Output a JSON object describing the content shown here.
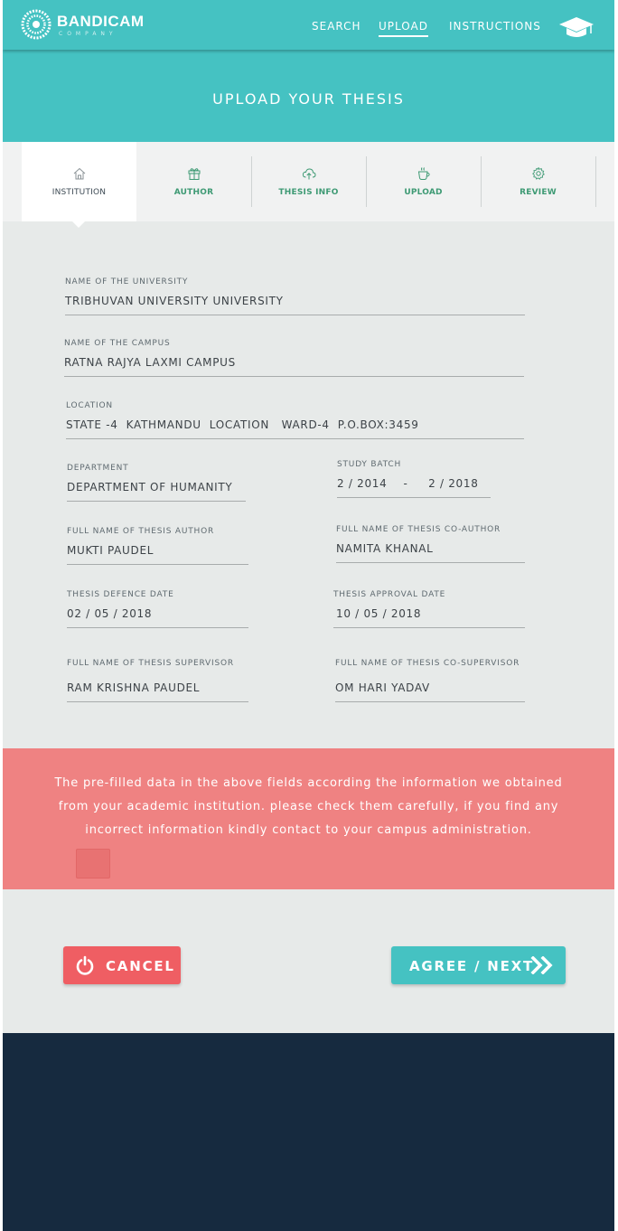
{
  "brand": {
    "name": "BANDICAM",
    "sub": "COMPANY"
  },
  "nav": {
    "search": "SEARCH",
    "upload": "UPLOAD",
    "instructions": "INSTRUCTIONS"
  },
  "page_title": "UPLOAD YOUR THESIS",
  "tabs": [
    {
      "label": "INSTITUTION",
      "icon": "home-icon",
      "active": true
    },
    {
      "label": "AUTHOR",
      "icon": "gift-icon"
    },
    {
      "label": "THESIS INFO",
      "icon": "cloud-upload-icon"
    },
    {
      "label": "UPLOAD",
      "icon": "coffee-cup-icon"
    },
    {
      "label": "REVIEW",
      "icon": "gear-icon"
    }
  ],
  "form": {
    "university": {
      "label": "NAME OF THE UNIVERSITY",
      "value": "TRIBHUVAN UNIVERSITY UNIVERSITY"
    },
    "campus": {
      "label": "NAME OF THE CAMPUS",
      "value": "RATNA RAJYA LAXMI CAMPUS"
    },
    "location": {
      "label": "LOCATION",
      "value": "STATE -4  KATHMANDU  LOCATION   WARD-4  P.O.BOX:3459"
    },
    "department": {
      "label": "DEPARTMENT",
      "value": "DEPARTMENT OF HUMANITY"
    },
    "study_batch": {
      "label": "STUDY BATCH",
      "value": "2 / 2014    -     2 / 2018"
    },
    "author": {
      "label": "FULL NAME OF THESIS AUTHOR",
      "value": "MUKTI PAUDEL"
    },
    "coauthor": {
      "label": "FULL NAME OF THESIS CO-AUTHOR",
      "value": "NAMITA KHANAL"
    },
    "defence_date": {
      "label": "THESIS DEFENCE DATE",
      "value": "02 / 05 / 2018"
    },
    "approval_date": {
      "label": "THESIS APPROVAL DATE",
      "value": "10 / 05 / 2018"
    },
    "supervisor": {
      "label": "FULL NAME OF THESIS SUPERVISOR",
      "value": "RAM KRISHNA PAUDEL"
    },
    "cosupervisor": {
      "label": "FULL NAME OF THESIS CO-SUPERVISOR",
      "value": "OM HARI YADAV"
    }
  },
  "notice": {
    "line1": "The pre-filled data in the above fields according the information we obtained",
    "line2": "from your academic institution. please check them carefully, if you find any",
    "line3": "incorrect information kindly contact to your campus administration."
  },
  "buttons": {
    "cancel": "CANCEL",
    "next": "AGREE / NEXT"
  },
  "colors": {
    "teal": "#45c2c2",
    "salmon": "#ef8282",
    "red": "#ef5e63",
    "navy": "#162a3f",
    "tab_green": "#3e9a74"
  }
}
